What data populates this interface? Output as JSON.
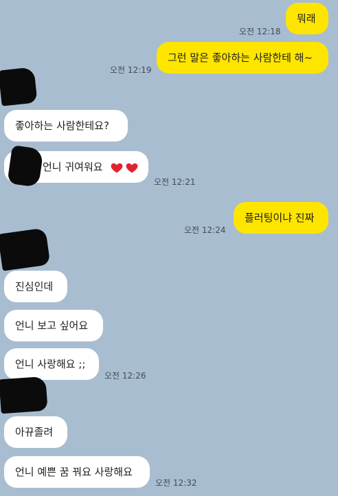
{
  "messages": [
    {
      "id": "m1",
      "from": "me",
      "text": "뭐래",
      "time": "오전 12:18"
    },
    {
      "id": "m2",
      "from": "me",
      "text": "그런 말은 좋아하는 사람한테 해~",
      "time": "오전 12:19"
    },
    {
      "id": "m3",
      "from": "them",
      "text": "좋아하는 사람한테요?",
      "time": ""
    },
    {
      "id": "m4",
      "from": "them",
      "text": "언니 귀여워요",
      "time": "오전 12:21",
      "icons": [
        "red-heart-icon",
        "red-heart-icon"
      ]
    },
    {
      "id": "m5",
      "from": "me",
      "text": "플러팅이냐 진짜",
      "time": "오전 12:24"
    },
    {
      "id": "m6",
      "from": "them",
      "text": "진심인데",
      "time": ""
    },
    {
      "id": "m7",
      "from": "them",
      "text": "언니 보고 싶어요",
      "time": ""
    },
    {
      "id": "m8",
      "from": "them",
      "text": "언니 사랑해요 ;;",
      "time": "오전 12:26"
    },
    {
      "id": "m9",
      "from": "them",
      "text": "아뀨졸려",
      "time": ""
    },
    {
      "id": "m10",
      "from": "them",
      "text": "언니 예쁜 꿈 꿔요 사랑해요",
      "time": "오전 12:32"
    }
  ],
  "colors": {
    "background": "#a9bdd0",
    "my_bubble": "#fee500",
    "their_bubble": "#ffffff",
    "heart": "#e0242f"
  }
}
